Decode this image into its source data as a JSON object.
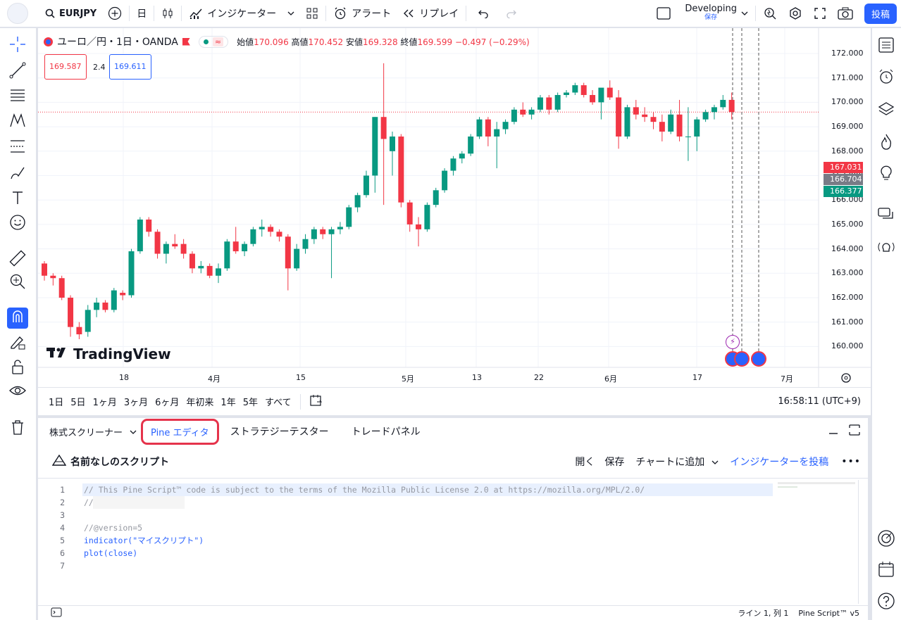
{
  "topbar": {
    "symbol": "EURJPY",
    "interval": "日",
    "indicators": "インジケーター",
    "alert": "アラート",
    "replay": "リプレイ",
    "layout_name": "Developing",
    "layout_status": "保存",
    "publish": "投稿"
  },
  "legend": {
    "title": "ユーロ／円・1日・OANDA",
    "o_label": "始値",
    "o": "170.096",
    "h_label": "高値",
    "h": "170.452",
    "l_label": "安値",
    "l": "169.328",
    "c_label": "終値",
    "c": "169.599",
    "change": "−0.497 (−0.29%)",
    "sell_price": "169.587",
    "spread": "2.4",
    "buy_price": "169.611"
  },
  "chart": {
    "watermark": "TradingView",
    "y_ticks": [
      "172.000",
      "171.000",
      "170.000",
      "169.000",
      "168.000",
      "167.000",
      "166.000",
      "165.000",
      "164.000",
      "163.000",
      "162.000",
      "161.000",
      "160.000"
    ],
    "x_ticks": [
      "18",
      "4月",
      "15",
      "5月",
      "13",
      "22",
      "6月",
      "17",
      "7月"
    ],
    "tag_red": "167.031",
    "tag_gray": "166.704",
    "tag_green": "166.377",
    "colors": {
      "up": "#089981",
      "down": "#f23645",
      "accent": "#2962ff"
    }
  },
  "chart_data": {
    "type": "candlestick",
    "ylim": [
      159.4,
      172.4
    ],
    "candles": [
      {
        "o": 163.4,
        "h": 163.5,
        "l": 162.7,
        "c": 162.9
      },
      {
        "o": 162.9,
        "h": 163.0,
        "l": 162.5,
        "c": 162.8
      },
      {
        "o": 162.8,
        "h": 162.9,
        "l": 161.9,
        "c": 162.0
      },
      {
        "o": 162.0,
        "h": 162.1,
        "l": 160.4,
        "c": 160.8
      },
      {
        "o": 160.8,
        "h": 161.0,
        "l": 160.3,
        "c": 160.5
      },
      {
        "o": 160.6,
        "h": 161.7,
        "l": 160.4,
        "c": 161.5
      },
      {
        "o": 161.5,
        "h": 162.0,
        "l": 161.2,
        "c": 161.8
      },
      {
        "o": 161.8,
        "h": 161.9,
        "l": 161.4,
        "c": 161.5
      },
      {
        "o": 161.5,
        "h": 162.4,
        "l": 161.4,
        "c": 162.3
      },
      {
        "o": 162.2,
        "h": 162.3,
        "l": 161.9,
        "c": 162.1
      },
      {
        "o": 162.1,
        "h": 164.0,
        "l": 162.0,
        "c": 163.9
      },
      {
        "o": 163.9,
        "h": 165.3,
        "l": 163.8,
        "c": 165.2
      },
      {
        "o": 165.2,
        "h": 165.3,
        "l": 164.5,
        "c": 164.7
      },
      {
        "o": 164.7,
        "h": 164.8,
        "l": 163.6,
        "c": 163.8
      },
      {
        "o": 163.8,
        "h": 164.3,
        "l": 163.4,
        "c": 164.2
      },
      {
        "o": 164.2,
        "h": 164.6,
        "l": 164.0,
        "c": 164.1
      },
      {
        "o": 164.2,
        "h": 164.4,
        "l": 163.6,
        "c": 163.8
      },
      {
        "o": 163.8,
        "h": 163.9,
        "l": 163.0,
        "c": 163.2
      },
      {
        "o": 163.2,
        "h": 163.5,
        "l": 163.0,
        "c": 163.3
      },
      {
        "o": 163.3,
        "h": 163.4,
        "l": 162.8,
        "c": 162.9
      },
      {
        "o": 162.9,
        "h": 163.4,
        "l": 162.6,
        "c": 163.2
      },
      {
        "o": 163.2,
        "h": 164.4,
        "l": 163.1,
        "c": 164.3
      },
      {
        "o": 164.3,
        "h": 164.9,
        "l": 163.8,
        "c": 163.9
      },
      {
        "o": 163.9,
        "h": 164.3,
        "l": 163.7,
        "c": 164.2
      },
      {
        "o": 164.2,
        "h": 164.9,
        "l": 164.1,
        "c": 164.8
      },
      {
        "o": 164.8,
        "h": 165.2,
        "l": 164.5,
        "c": 164.9
      },
      {
        "o": 164.9,
        "h": 165.0,
        "l": 164.5,
        "c": 164.7
      },
      {
        "o": 164.7,
        "h": 164.8,
        "l": 164.3,
        "c": 164.5
      },
      {
        "o": 164.5,
        "h": 164.6,
        "l": 162.3,
        "c": 163.2
      },
      {
        "o": 163.2,
        "h": 164.2,
        "l": 163.1,
        "c": 164.0
      },
      {
        "o": 164.0,
        "h": 164.6,
        "l": 163.8,
        "c": 164.4
      },
      {
        "o": 164.4,
        "h": 164.9,
        "l": 164.2,
        "c": 164.8
      },
      {
        "o": 164.8,
        "h": 164.9,
        "l": 164.4,
        "c": 164.6
      },
      {
        "o": 164.6,
        "h": 164.9,
        "l": 162.8,
        "c": 164.8
      },
      {
        "o": 164.8,
        "h": 165.1,
        "l": 164.6,
        "c": 164.9
      },
      {
        "o": 164.9,
        "h": 165.8,
        "l": 164.8,
        "c": 165.7
      },
      {
        "o": 165.7,
        "h": 166.3,
        "l": 165.5,
        "c": 166.2
      },
      {
        "o": 166.2,
        "h": 167.2,
        "l": 166.1,
        "c": 167.0
      },
      {
        "o": 167.0,
        "h": 169.4,
        "l": 166.3,
        "c": 169.4
      },
      {
        "o": 169.4,
        "h": 171.6,
        "l": 165.8,
        "c": 168.5
      },
      {
        "o": 168.0,
        "h": 168.8,
        "l": 167.0,
        "c": 168.6
      },
      {
        "o": 168.6,
        "h": 168.7,
        "l": 165.7,
        "c": 165.9
      },
      {
        "o": 165.9,
        "h": 166.0,
        "l": 164.7,
        "c": 165.0
      },
      {
        "o": 165.0,
        "h": 165.3,
        "l": 164.1,
        "c": 164.8
      },
      {
        "o": 164.8,
        "h": 165.9,
        "l": 164.7,
        "c": 165.8
      },
      {
        "o": 165.8,
        "h": 166.5,
        "l": 165.7,
        "c": 166.4
      },
      {
        "o": 166.4,
        "h": 167.3,
        "l": 166.3,
        "c": 167.2
      },
      {
        "o": 167.2,
        "h": 167.8,
        "l": 167.0,
        "c": 167.7
      },
      {
        "o": 167.7,
        "h": 168.0,
        "l": 167.5,
        "c": 167.9
      },
      {
        "o": 167.9,
        "h": 168.7,
        "l": 167.8,
        "c": 168.6
      },
      {
        "o": 168.6,
        "h": 169.4,
        "l": 168.5,
        "c": 169.3
      },
      {
        "o": 169.3,
        "h": 169.4,
        "l": 168.2,
        "c": 168.6
      },
      {
        "o": 168.6,
        "h": 169.2,
        "l": 167.3,
        "c": 168.9
      },
      {
        "o": 168.9,
        "h": 169.3,
        "l": 168.7,
        "c": 169.2
      },
      {
        "o": 169.2,
        "h": 169.8,
        "l": 169.1,
        "c": 169.7
      },
      {
        "o": 169.7,
        "h": 170.0,
        "l": 169.4,
        "c": 169.5
      },
      {
        "o": 169.5,
        "h": 169.8,
        "l": 169.3,
        "c": 169.7
      },
      {
        "o": 169.7,
        "h": 170.3,
        "l": 169.6,
        "c": 170.2
      },
      {
        "o": 170.2,
        "h": 170.3,
        "l": 169.5,
        "c": 169.7
      },
      {
        "o": 169.7,
        "h": 170.4,
        "l": 169.6,
        "c": 170.3
      },
      {
        "o": 170.3,
        "h": 170.5,
        "l": 170.2,
        "c": 170.4
      },
      {
        "o": 170.4,
        "h": 170.8,
        "l": 170.3,
        "c": 170.7
      },
      {
        "o": 170.7,
        "h": 170.8,
        "l": 170.2,
        "c": 170.3
      },
      {
        "o": 170.3,
        "h": 170.5,
        "l": 169.9,
        "c": 170.0
      },
      {
        "o": 170.0,
        "h": 170.2,
        "l": 169.3,
        "c": 170.6
      },
      {
        "o": 170.6,
        "h": 170.9,
        "l": 170.1,
        "c": 170.2
      },
      {
        "o": 170.2,
        "h": 170.5,
        "l": 168.1,
        "c": 168.6
      },
      {
        "o": 168.6,
        "h": 169.9,
        "l": 168.5,
        "c": 169.8
      },
      {
        "o": 169.8,
        "h": 170.1,
        "l": 169.3,
        "c": 169.5
      },
      {
        "o": 169.5,
        "h": 169.8,
        "l": 169.2,
        "c": 169.4
      },
      {
        "o": 169.4,
        "h": 169.6,
        "l": 168.9,
        "c": 169.2
      },
      {
        "o": 169.2,
        "h": 169.5,
        "l": 168.4,
        "c": 168.8
      },
      {
        "o": 168.8,
        "h": 169.7,
        "l": 168.7,
        "c": 169.5
      },
      {
        "o": 169.5,
        "h": 170.1,
        "l": 168.4,
        "c": 168.6
      },
      {
        "o": 168.6,
        "h": 169.8,
        "l": 167.6,
        "c": 168.6
      },
      {
        "o": 168.6,
        "h": 169.4,
        "l": 168.0,
        "c": 169.3
      },
      {
        "o": 169.3,
        "h": 169.7,
        "l": 169.2,
        "c": 169.6
      },
      {
        "o": 169.6,
        "h": 169.9,
        "l": 169.3,
        "c": 169.8
      },
      {
        "o": 169.8,
        "h": 170.3,
        "l": 169.7,
        "c": 170.1
      },
      {
        "o": 170.1,
        "h": 170.4,
        "l": 169.3,
        "c": 169.6
      }
    ]
  },
  "timeframes": [
    "1日",
    "5日",
    "1ヶ月",
    "3ヶ月",
    "6ヶ月",
    "年初来",
    "1年",
    "5年",
    "すべて"
  ],
  "clock": "16:58:11 (UTC+9)",
  "panel": {
    "tabs": [
      "株式スクリーナー",
      "Pine エディタ",
      "ストラテジーテスター",
      "トレードパネル"
    ],
    "script_name": "名前なしのスクリプト",
    "open": "開く",
    "save": "保存",
    "add_to_chart": "チャートに追加",
    "publish_indicator": "インジケーターを投稿",
    "status_pos": "ライン 1, 列 1",
    "status_lang": "Pine Script™ v5"
  },
  "code_lines": [
    {
      "n": "1",
      "text": "// This Pine Script™ code is subject to the terms of the Mozilla Public License 2.0 at https://mozilla.org/MPL/2.0/"
    },
    {
      "n": "2",
      "text": "// "
    },
    {
      "n": "3",
      "text": ""
    },
    {
      "n": "4",
      "text": "//@version=5"
    },
    {
      "n": "5",
      "text": "indicator(\"マイスクリプト\")"
    },
    {
      "n": "6",
      "text": "plot(close)"
    },
    {
      "n": "7",
      "text": ""
    }
  ]
}
